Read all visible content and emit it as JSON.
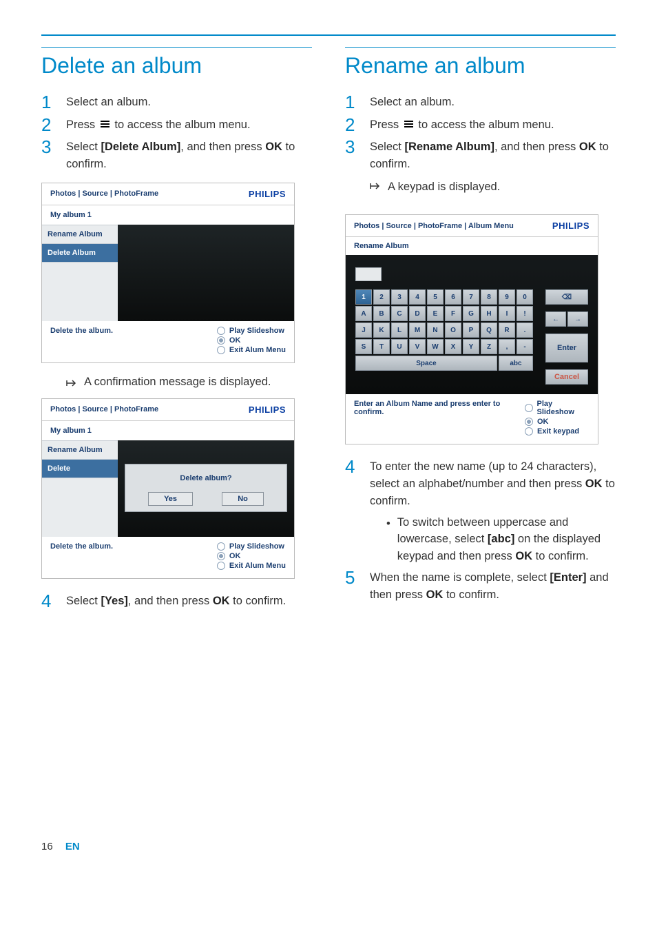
{
  "left": {
    "title": "Delete an album",
    "steps": [
      {
        "num": "1",
        "text": "Select an album."
      },
      {
        "num": "2",
        "pre": "Press ",
        "post": " to access the album menu."
      },
      {
        "num": "3",
        "pre": "Select ",
        "bold1": "[Delete Album]",
        "mid": ", and then press ",
        "bold2": "OK",
        "post": " to confirm."
      }
    ],
    "result": "A confirmation message is displayed.",
    "step4": {
      "num": "4",
      "pre": "Select ",
      "bold1": "[Yes]",
      "mid": ", and then press ",
      "bold2": "OK",
      "post": " to confirm."
    },
    "panel1": {
      "breadcrumb": "Photos | Source | PhotoFrame",
      "brand": "PHILIPS",
      "sub": "My album 1",
      "side": [
        "Rename Album",
        "Delete Album"
      ],
      "footer_hint": "Delete the album.",
      "legend": [
        "Play Slideshow",
        "OK",
        "Exit Alum Menu"
      ]
    },
    "panel2": {
      "breadcrumb": "Photos | Source | PhotoFrame",
      "brand": "PHILIPS",
      "sub": "My album 1",
      "side": [
        "Rename Album",
        "Delete"
      ],
      "dialog_q": "Delete album?",
      "dialog_yes": "Yes",
      "dialog_no": "No",
      "footer_hint": "Delete the album.",
      "legend": [
        "Play Slideshow",
        "OK",
        "Exit Alum Menu"
      ]
    }
  },
  "right": {
    "title": "Rename an album",
    "steps": [
      {
        "num": "1",
        "text": "Select an album."
      },
      {
        "num": "2",
        "pre": "Press ",
        "post": " to access the album menu."
      },
      {
        "num": "3",
        "pre": "Select ",
        "bold1": "[Rename Album]",
        "mid": ", and then press ",
        "bold2": "OK",
        "post": " to confirm."
      }
    ],
    "result": "A keypad is displayed.",
    "kp": {
      "breadcrumb": "Photos | Source | PhotoFrame | Album Menu",
      "brand": "PHILIPS",
      "sub": "Rename Album",
      "rows": [
        [
          "1",
          "2",
          "3",
          "4",
          "5",
          "6",
          "7",
          "8",
          "9",
          "0"
        ],
        [
          "A",
          "B",
          "C",
          "D",
          "E",
          "F",
          "G",
          "H",
          "I",
          "!"
        ],
        [
          "J",
          "K",
          "L",
          "M",
          "N",
          "O",
          "P",
          "Q",
          "R",
          "."
        ],
        [
          "S",
          "T",
          "U",
          "V",
          "W",
          "X",
          "Y",
          "Z",
          ",",
          "-"
        ]
      ],
      "space": "Space",
      "abc": "abc",
      "bksp": "⌫",
      "left": "←",
      "right": "→",
      "enter": "Enter",
      "cancel": "Cancel",
      "footer_hint": "Enter an Album Name and press enter to confirm.",
      "legend": [
        "Play Slideshow",
        "OK",
        "Exit keypad"
      ]
    },
    "step4": {
      "num": "4",
      "text_a": "To enter the new name (up to 24 characters), select an alphabet/number and then press ",
      "bold": "OK",
      "text_b": " to confirm."
    },
    "bullet": {
      "pre": "To switch between uppercase and lowercase, select ",
      "bold1": "[abc]",
      "mid": " on the displayed keypad and then press ",
      "bold2": "OK",
      "post": " to confirm."
    },
    "step5": {
      "num": "5",
      "pre": "When the name is complete, select ",
      "bold1": "[Enter]",
      "mid": " and then press ",
      "bold2": "OK",
      "post": " to confirm."
    }
  },
  "footer": {
    "page": "16",
    "lang": "EN"
  }
}
